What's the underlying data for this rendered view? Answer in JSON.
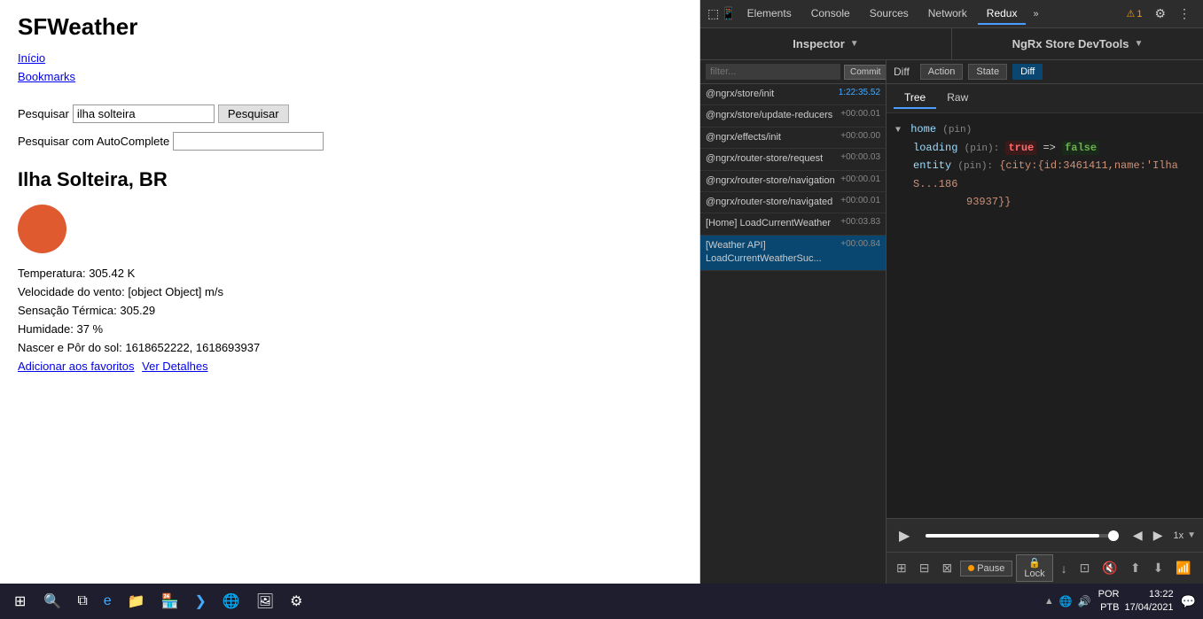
{
  "app": {
    "title": "SFWeather",
    "nav": {
      "inicio": "Início",
      "bookmarks": "Bookmarks"
    },
    "search": {
      "label": "Pesquisar",
      "value": "ilha solteira",
      "button": "Pesquisar"
    },
    "autocomplete": {
      "label": "Pesquisar com AutoComplete",
      "value": ""
    },
    "city": "Ilha Solteira, BR",
    "weather": {
      "temperatura": "Temperatura: 305.42 K",
      "vento": "Velocidade do vento: [object Object] m/s",
      "sensacao": "Sensação Térmica: 305.29",
      "humidade": "Humidade: 37 %",
      "nascer": "Nascer e Pôr do sol: 1618652222, 1618693937"
    },
    "links": {
      "favoritos": "Adicionar aos favoritos",
      "detalhes": "Ver Detalhes"
    }
  },
  "devtools": {
    "tabs": [
      "Elements",
      "Console",
      "Sources",
      "Network",
      "Redux"
    ],
    "active_tab": "Redux",
    "warning_count": "1",
    "inspector_label": "Inspector",
    "ngrx_label": "NgRx Store DevTools",
    "filter_placeholder": "filter...",
    "commit_button": "Commit",
    "actions": [
      {
        "name": "@ngrx/store/init",
        "time": "1:22:35.52"
      },
      {
        "name": "@ngrx/store/update-reducers",
        "time": "+00:00.01"
      },
      {
        "name": "@ngrx/effects/init",
        "time": "+00:00.00"
      },
      {
        "name": "@ngrx/router-store/request",
        "time": "+00:00.03"
      },
      {
        "name": "@ngrx/router-store/navigation",
        "time": "+00:00.01"
      },
      {
        "name": "@ngrx/router-store/navigated",
        "time": "+00:00.01"
      },
      {
        "name": "[Home] LoadCurrentWeather",
        "time": "+00:03.83"
      },
      {
        "name": "[Weather API] LoadCurrentWeatherSuc...",
        "time": "+00:00.84"
      }
    ],
    "diff_tab": "Diff",
    "action_tab": "Action",
    "state_tab": "State",
    "diff_active": "Diff",
    "tree_tab": "Tree",
    "raw_tab": "Raw",
    "tree": {
      "home_pin": "home (pin)",
      "loading_key": "loading",
      "loading_pin": "(pin):",
      "loading_true": "true",
      "loading_arrow": "=>",
      "loading_false": "false",
      "entity_key": "entity",
      "entity_pin": "(pin):",
      "entity_value": "{city:{id:3461411,name:'Ilha S...186",
      "entity_value2": "93937}}"
    },
    "speed": "1x",
    "bottom_icons": [
      "⊞",
      "⊟",
      "⊠",
      "⏸",
      "🔒",
      "↓",
      "⊡",
      "🔇",
      "⬆",
      "⬇",
      "📶",
      "⚙"
    ]
  },
  "taskbar": {
    "time": "13:22",
    "date": "17/04/2021",
    "lang": "POR",
    "region": "PTB"
  }
}
